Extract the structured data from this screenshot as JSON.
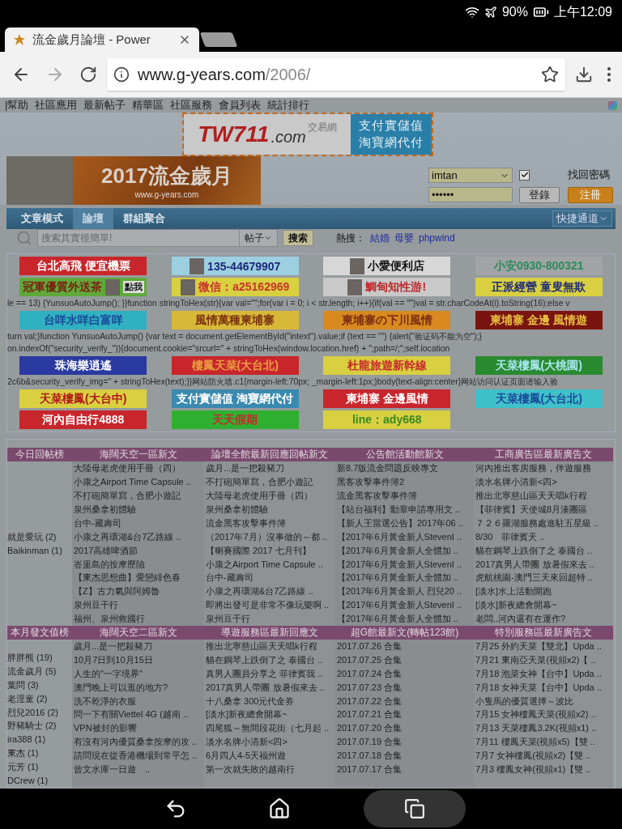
{
  "status_bar": {
    "battery": "90%",
    "time": "上午12:09"
  },
  "browser": {
    "tab_title": "流金歲月論壇 - Power",
    "url_domain": "www.g-years.com",
    "url_path": "/2006/"
  },
  "top_links": [
    "|幫助",
    "社區應用",
    "最新帖子",
    "精華區",
    "社區服務",
    "會員列表",
    "統計排行"
  ],
  "banner": {
    "logo": "TW711",
    "logo_suffix": ".com",
    "logo_tag": "交易網",
    "lines": [
      "支付實儲值",
      "淘寶網代付"
    ]
  },
  "site_logo": {
    "title": "2017流金歲月",
    "url": "www.g-years.com"
  },
  "login": {
    "username": "imtan",
    "password": "••••••",
    "remember_checked": true,
    "forgot": "找回密碼",
    "login_button": "登錄",
    "register_button": "注冊"
  },
  "nav": {
    "tabs": [
      {
        "label": "文章模式",
        "selected": false
      },
      {
        "label": "論壇",
        "selected": true
      },
      {
        "label": "群組聚合",
        "selected": false
      }
    ],
    "shortcut": "快捷通道"
  },
  "search": {
    "placeholder": "搜索其實很簡單!",
    "scope": "帖子",
    "button": "搜索",
    "hot_label": "熱搜：",
    "hot": [
      "結婚",
      "母嬰",
      "phpwind"
    ]
  },
  "ads": [
    {
      "label": {
        "text": "台北高飛 便宜機票",
        "color": "#ffffff"
      },
      "color": "#c8262c",
      "kind": "plain"
    },
    {
      "label": {
        "text": "135-44679907",
        "color": "#1c2a7a"
      },
      "color": "#9ccfe0",
      "kind": "image_left"
    },
    {
      "label": {
        "text": "小愛便利店",
        "color": "#111111"
      },
      "color": "#d7d7d7",
      "kind": "image_left"
    },
    {
      "label": {
        "text": "小安0930-800321",
        "color": "#2e8a5a"
      },
      "color": "#a0a4a6",
      "kind": "plain"
    },
    {
      "label": {
        "text": "冠軍優質外送茶",
        "color": "#7a1f10"
      },
      "color": "#5fa93a",
      "kind": "image_right",
      "tag": "點我"
    },
    {
      "label": {
        "text": "微信：a25162969",
        "color": "#c8342a"
      },
      "color": "#d8d040",
      "kind": "image_left"
    },
    {
      "label": {
        "text": "鯛甸知性游!",
        "color": "#c0282a"
      },
      "color": "#c9c9c9",
      "kind": "image_left"
    },
    {
      "label": {
        "text": "正派經營 童叟無欺",
        "color": "#1f2a78"
      },
      "color": "#d8d040",
      "kind": "plain"
    },
    {
      "label": {
        "text": "台咩水咩白富咩",
        "color": "#1a4a9a"
      },
      "color": "#30b0c0",
      "kind": "plain"
    },
    {
      "label": {
        "text": "風情萬種柬埔寨",
        "color": "#7a3010"
      },
      "color": "#d8b838",
      "kind": "plain"
    },
    {
      "label": {
        "text": "柬埔寨の下川風情",
        "color": "#7a2a10"
      },
      "color": "#d88a20",
      "kind": "plain"
    },
    {
      "label": {
        "text": "柬埔寨 金邊 風情遊",
        "color": "#e8c040"
      },
      "color": "#7a1410",
      "kind": "plain"
    },
    {
      "label": {
        "text": "珠海樂逍遙",
        "color": "#ffffff"
      },
      "color": "#2a3aa0",
      "kind": "plain"
    },
    {
      "label": {
        "text": "樓鳳天菜(大台北)",
        "color": "#e8a040"
      },
      "color": "#c8262c",
      "kind": "plain"
    },
    {
      "label": {
        "text": "杜龍旅遊新幹線",
        "color": "#c8262c"
      },
      "color": "#d8d040",
      "kind": "plain"
    },
    {
      "label": {
        "text": "天菜樓鳳(大桃園)",
        "color": "#a8e8f0"
      },
      "color": "#2a8a30",
      "kind": "plain"
    },
    {
      "label": {
        "text": "天菜樓鳳(大台中)",
        "color": "#b01818"
      },
      "color": "#d8d040",
      "kind": "plain"
    },
    {
      "label": {
        "text": "支付實儲值 淘寶網代付",
        "color": "#ffffff"
      },
      "color": "#3a8ab0",
      "kind": "plain"
    },
    {
      "label": {
        "text": "柬埔寨 金邊風情",
        "color": "#ffffff"
      },
      "color": "#c8262c",
      "kind": "plain"
    },
    {
      "label": {
        "text": "天菜樓鳳(大台北)",
        "color": "#1a4a9a"
      },
      "color": "#40c0c8",
      "kind": "plain"
    },
    {
      "label": {
        "text": "河內自由行4888",
        "color": "#ffffff"
      },
      "color": "#c8262c",
      "kind": "plain"
    },
    {
      "label": {
        "text": "天天假期",
        "color": "#c8262c"
      },
      "color": "#30b030",
      "kind": "plain"
    },
    {
      "label": {
        "text": "line：ady668",
        "color": "#3a8a20"
      },
      "color": "#d8d040",
      "kind": "plain"
    }
  ],
  "code_lines": [
    "le == 13) {YunsuoAutoJump(); }}function stringToHex(str){var val=\"\";for(var i = 0; i < str.length; i++){if(val == \"\")val = str.charCodeAt(i).toString(16);else v",
    "turn val;}function YunsuoAutoJump() {var text = document.getElementById(\"intext\").value;if (text == \"\") {alert(\"验证码不能为空\");}",
    "on.indexOf(\"security_verify_\")){document.cookie=\"srcurl=\" + stringToHex(window.location.href) + \";path=/;\";self.location",
    "2c6b&security_verify_img=\" + stringToHex(text);}}网站防火墙.c1{margin-left:70px; _margin-left:1px;}body{text-align:center}网站访问认证页面请输入验"
  ],
  "tables": [
    {
      "headers": [
        "今日回帖榜",
        "海闊天空一區新文",
        "論壇全館最新回應回帖新文",
        "公告館活動館新文",
        "工商廣告區最新廣告文"
      ],
      "ranking": [
        "就是愛玩 (2)",
        "Baikinman (1)"
      ],
      "columns": [
        [
          "大陸母老虎使用手冊（四）",
          "小康之Airport Time Capsule ..",
          "不打砲簡單寫，合肥小遊記",
          "泉州桑拿初體驗",
          "台中-藏壽司",
          "小康之再環湖&台7乙路線 ..",
          "2017高雄啤酒節",
          "峇里島的按摩歷險",
          "【東杰思想曲】愛戀緋色春",
          "【Z】古力氣與阿姆魯",
          "泉州豆干行",
          "福州、泉州救國行"
        ],
        [
          "歲月...是一把殺豬刀",
          "不打砲簡單寫，合肥小遊記",
          "大陸母老虎使用手冊（四）",
          "泉州桑拿初體驗",
          "流金黑客攻擊事件簿",
          "（2017年7月）沒事做的～都 ..",
          "【喇賽國際 2017 七月刊】",
          "小康之Airport Time Capsule ..",
          "台中-藏壽司",
          "小康之再環湖&台7乙路線 ..",
          "即將出發可是非常不像玩樂啊 ..",
          "泉州豆干行"
        ],
        [
          "新8.7版流金問題反映專文",
          "黑客攻擊事件簿2",
          "流金黑客攻擊事件簿",
          "【站台福利】勳章申請專用文 ..",
          "【新人王當選公告】2017年06 ..",
          "【2017年6月黃金新人StevenI ..",
          "【2017年6月黃金新人全體加 ..",
          "【2017年6月黃金新人StevenI ..",
          "【2017年6月黃金新人全體加 ..",
          "【2017年6月黃金新人 烈兒20 ..",
          "【2017年6月黃金新人StevenI ..",
          "【2017年6月黃金新人全體加 .."
        ],
        [
          "河內推出客房服務，伴遊服務",
          "淡水名牌小清新<四>",
          "推出北寧慈山區天天唱k行程",
          "【菲律賓】天使城8月湊團區",
          "７２６羅湖服務處進駐五星級 ..",
          "8/30　菲律賓天 ..",
          "貓在鋼琴上跌倒了之 泰國台 ..",
          "2017真男人帶團 放暑假來去 ..",
          "虎航桃園-澳門三天來回超特 ..",
          "[淡水]水上活動開跑",
          "[淡水]新夜總會開幕~",
          "老闆..河內還有在運作?"
        ]
      ]
    },
    {
      "headers": [
        "本月發文值榜",
        "海闊天空二區新文",
        "導遊服務區最新回應文",
        "超G館最新文(轉帖123館)",
        "特別服務區最新廣告文"
      ],
      "ranking": [
        "胖胖熊 (19)",
        "流金歲月 (5)",
        "葉問 (3)",
        "老淫童 (2)",
        "烈兒2016 (2)",
        "野豬騎士 (2)",
        "ira388 (1)",
        "東杰 (1)",
        "元芳 (1)",
        "DCrew (1)"
      ],
      "columns": [
        [
          "歲月...是一把殺豬刀",
          "10月7日到10月15日",
          "人生的\"一字境界\"",
          "澳門晚上可以逛的地方?",
          "洗不乾淨的衣服",
          "問一下有關Viettel 4G (越南 ..",
          "VPN被封的影響",
          "有沒有河內優質桑拿按摩的攻 ..",
          "請問現在從香港機場到常平怎 ..",
          "曾文水庫一日遊　.."
        ],
        [
          "推出北寧慈山區天天唱k行程",
          "貓在鋼琴上跌倒了之 泰國台 ..",
          "真男人團員分享之 菲律賓我 ..",
          "2017真男人帶團 放暑假來去 ..",
          "十八桑拿 300元代金券",
          "[淡水]新夜總會開幕~",
          "四尾狐～無間段花街（七月起 ..",
          "淡水名牌小清新<四>",
          "6月四人4-5天福州遊",
          "第一次就失敗的越南行"
        ],
        [
          "2017.07.26 合集",
          "2017.07.25 合集",
          "2017.07.24 合集",
          "2017.07.23 合集",
          "2017.07.22 合集",
          "2017.07.21 合集",
          "2017.07.20 合集",
          "2017.07.19 合集",
          "2017.07.18 合集",
          "2017.07.17 合集"
        ],
        [
          "7月25 外約天菜【雙北】Upda ..",
          "7月21 東南亞天菜(視頻x2)【 ..",
          "7月18 泡菜女神【台中】Upda ..",
          "7月18 女神天菜【台中】Upda ..",
          "小隻馬的優質選擇～波比",
          "7月15 女神樓鳳天菜(視頻x2) ..",
          "7月13 天菜樓鳳3.2K(視頻x1) ..",
          "7月11 樓鳳天菜(視頻x5)【雙 ..",
          "7月7 女神樓鳳(視頻x2)【雙 ..",
          "7月3 樓鳳女神(視頻x1)【雙 .."
        ]
      ]
    }
  ]
}
